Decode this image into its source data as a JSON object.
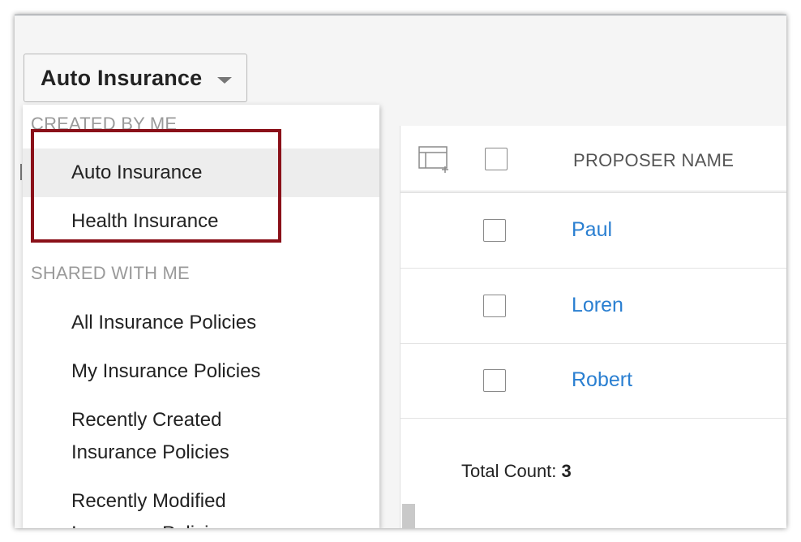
{
  "view_selector": {
    "label": "Auto Insurance"
  },
  "dropdown": {
    "created_by_me": {
      "label": "CREATED BY ME",
      "items": [
        "Auto Insurance",
        "Health Insurance"
      ]
    },
    "shared_with_me": {
      "label": "SHARED WITH ME",
      "items": [
        "All Insurance Policies",
        "My Insurance Policies",
        [
          "Recently Created",
          "Insurance Policies"
        ],
        [
          "Recently Modified",
          "Insurance Policies"
        ]
      ]
    }
  },
  "table": {
    "columns": [
      "PROPOSER NAME"
    ],
    "rows": [
      {
        "name": "Paul"
      },
      {
        "name": "Loren"
      },
      {
        "name": "Robert"
      }
    ]
  },
  "footer": {
    "total_label": "Total Count:",
    "total_value": "3"
  },
  "colors": {
    "link": "#2a7fd1",
    "highlight": "#8a1019",
    "selected_bg": "#ededed"
  }
}
